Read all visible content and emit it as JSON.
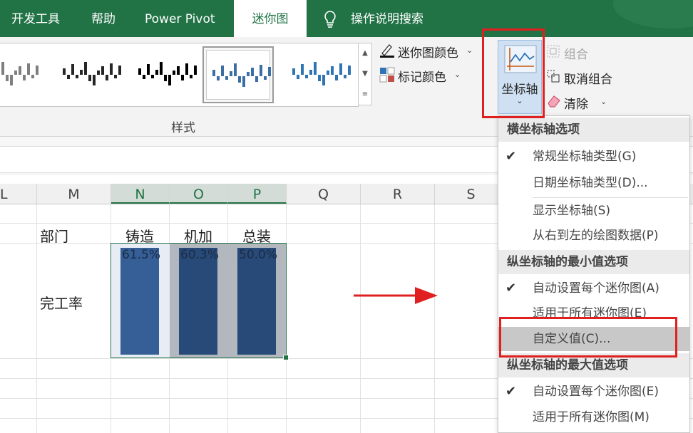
{
  "ribbon": {
    "tabs": [
      {
        "label": "开发工具",
        "active": false
      },
      {
        "label": "帮助",
        "active": false
      },
      {
        "label": "Power Pivot",
        "active": false
      },
      {
        "label": "迷你图",
        "active": true
      },
      {
        "label": "操作说明搜索",
        "active": false
      }
    ],
    "style_group_label": "样式",
    "sparkline_color_label": "迷你图颜色",
    "marker_color_label": "标记颜色",
    "axis_button_label": "坐标轴",
    "group_label": "组合",
    "ungroup_label": "取消组合",
    "clear_label": "清除",
    "gallery_colors": [
      "#7f7f7f",
      "#262626",
      "#000000",
      "#3a6ea5",
      "#2e75b6"
    ]
  },
  "sheet": {
    "columns": [
      "L",
      "M",
      "N",
      "O",
      "P",
      "Q",
      "R",
      "S"
    ],
    "selected_columns": [
      "N",
      "O",
      "P"
    ],
    "dept_label": "部门",
    "departments": [
      "铸造",
      "机加",
      "总装"
    ],
    "row_label": "完工率",
    "completion_rates": [
      61.5,
      60.3,
      50.0
    ],
    "completion_rate_labels": [
      "61.5%",
      "60.3%",
      "50.0%"
    ],
    "bar_color": "#284a78"
  },
  "menu": {
    "h_axis_header": "横坐标轴选项",
    "general_axis": "常规坐标轴类型(G)",
    "date_axis": "日期坐标轴类型(D)...",
    "show_axis": "显示坐标轴(S)",
    "rtl_data": "从右到左的绘图数据(P)",
    "v_min_header": "纵坐标轴的最小值选项",
    "min_auto_each": "自动设置每个迷你图(A)",
    "min_same_all": "适用于所有迷你图(E)",
    "min_custom": "自定义值(C)...",
    "v_max_header": "纵坐标轴的最大值选项",
    "max_auto_each": "自动设置每个迷你图(E)",
    "max_same_all": "适用于所有迷你图(M)",
    "checkmark": "✔"
  },
  "annotation": {
    "highlight_color": "#e02020"
  }
}
